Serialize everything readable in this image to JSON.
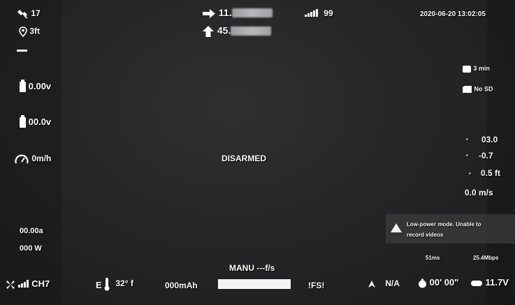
{
  "top": {
    "sats": "17",
    "home_dist": "3ft",
    "lat": "11.",
    "lon": "45.",
    "link_quality": "99",
    "datetime": "2020-06-20 13:02:05"
  },
  "left": {
    "battery1_voltage": "0.00v",
    "battery2_voltage": "00.0v",
    "speed": "0m/h",
    "current": "00.00a",
    "power": "000 W"
  },
  "right": {
    "record_time": "3 min",
    "sd_status": "No SD",
    "distance": "03.0",
    "vertical": "-0.7",
    "altitude": "0.5 ft",
    "vspeed": "0.0 m/s",
    "warning": "Low-power mode. Unable to record videos",
    "latency": "51ms",
    "bitrate": "25.4Mbps"
  },
  "center": {
    "status": "DISARMED",
    "flight_mode": "MANU ---f/s",
    "throttle_percent": 100
  },
  "bottom": {
    "channel": "CH7",
    "compass": "E",
    "temperature": "32° f",
    "mah": "000mAh",
    "failsafe": "!FS!",
    "heading_na": "N/A",
    "flight_time": "00' 00\"",
    "goggle_voltage": "11.7V"
  },
  "icons": {
    "satellite": "satellite-icon",
    "home": "home-pin-icon",
    "arrow_right": "arrow-right-icon",
    "arrow_up": "arrow-up-icon",
    "signal": "signal-bars-icon",
    "battery": "battery-icon",
    "speedometer": "speedometer-icon",
    "camera": "camera-icon",
    "sd_card": "sd-card-icon",
    "warning": "warning-triangle-icon",
    "thermometer": "thermometer-icon",
    "clock": "timer-icon",
    "goggles": "goggles-battery-icon"
  }
}
